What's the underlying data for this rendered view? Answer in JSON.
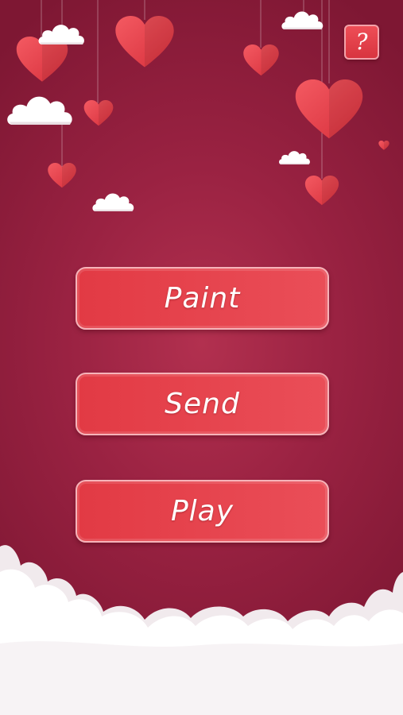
{
  "help": {
    "label": "?"
  },
  "menu": {
    "paint_label": "Paint",
    "send_label": "Send",
    "play_label": "Play"
  },
  "colors": {
    "background": "#9a2242",
    "button": "#e5424c",
    "button_border": "#f6b3b9",
    "heart": "#e53a45",
    "cloud": "#ffffff"
  }
}
